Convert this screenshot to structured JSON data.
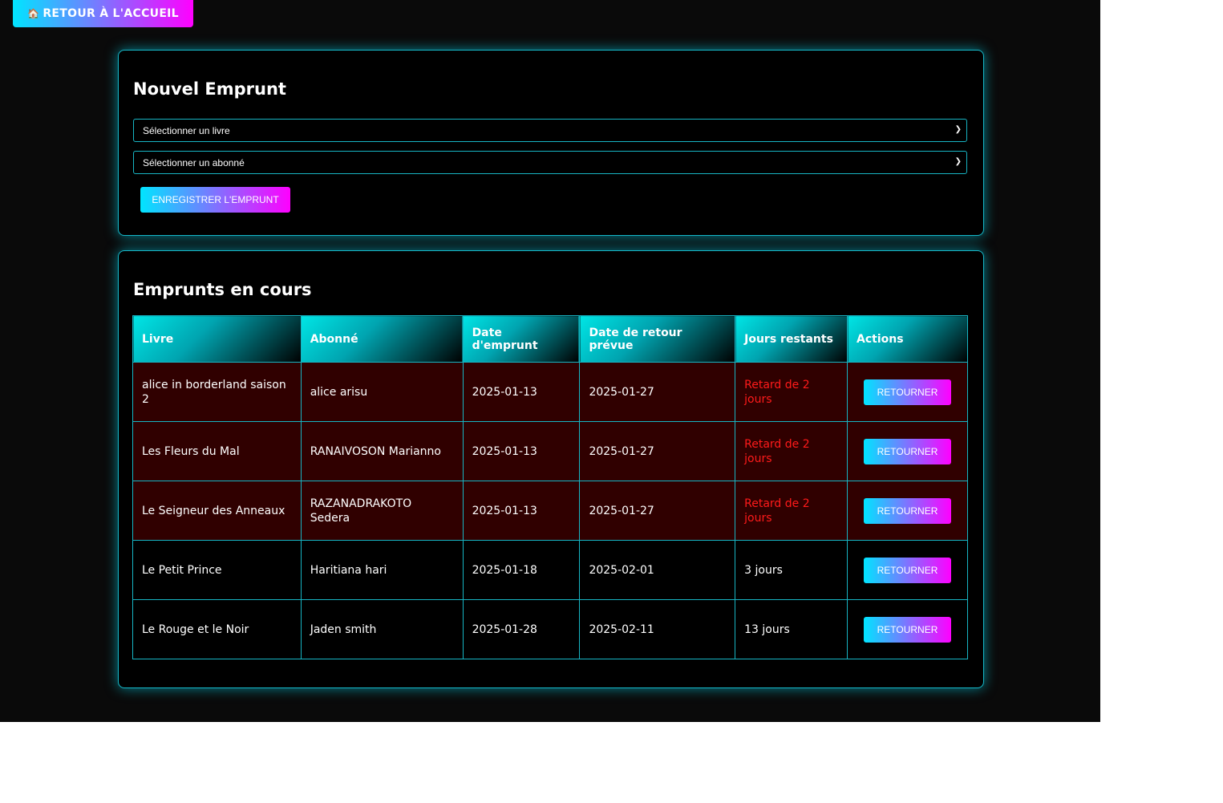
{
  "nav": {
    "home_icon": "house-icon",
    "home_label": "RETOUR À L'ACCUEIL"
  },
  "new_loan": {
    "title": "Nouvel Emprunt",
    "book_select": {
      "selected": "Sélectionner un livre"
    },
    "member_select": {
      "selected": "Sélectionner un abonné"
    },
    "submit_label": "ENREGISTRER L'EMPRUNT"
  },
  "current_loans": {
    "title": "Emprunts en cours",
    "columns": [
      "Livre",
      "Abonné",
      "Date d'emprunt",
      "Date de retour prévue",
      "Jours restants",
      "Actions"
    ],
    "rows": [
      {
        "book": "alice in borderland saison 2",
        "member": "alice arisu",
        "loan_date": "2025-01-13",
        "due_date": "2025-01-27",
        "remaining": "Retard de 2 jours",
        "late": true,
        "action": "RETOURNER"
      },
      {
        "book": "Les Fleurs du Mal",
        "member": "RANAIVOSON Marianno",
        "loan_date": "2025-01-13",
        "due_date": "2025-01-27",
        "remaining": "Retard de 2 jours",
        "late": true,
        "action": "RETOURNER"
      },
      {
        "book": "Le Seigneur des Anneaux",
        "member": "RAZANADRAKOTO Sedera",
        "loan_date": "2025-01-13",
        "due_date": "2025-01-27",
        "remaining": "Retard de 2 jours",
        "late": true,
        "action": "RETOURNER"
      },
      {
        "book": "Le Petit Prince",
        "member": "Haritiana hari",
        "loan_date": "2025-01-18",
        "due_date": "2025-02-01",
        "remaining": "3 jours",
        "late": false,
        "action": "RETOURNER"
      },
      {
        "book": "Le Rouge et le Noir",
        "member": "Jaden smith",
        "loan_date": "2025-01-28",
        "due_date": "2025-02-11",
        "remaining": "13 jours",
        "late": false,
        "action": "RETOURNER"
      }
    ]
  },
  "colors": {
    "accent_cyan": "#00e5ff",
    "accent_magenta": "#ff00ff",
    "late_red": "#ff1a1a",
    "late_row_bg": "#300000"
  }
}
